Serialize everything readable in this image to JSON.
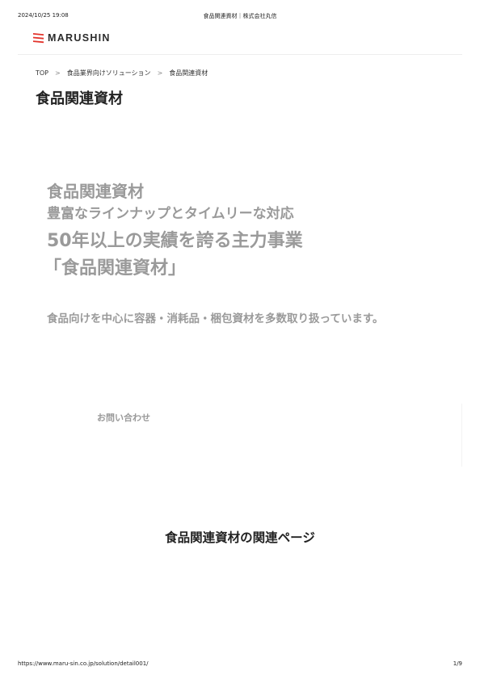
{
  "print_header": {
    "datetime": "2024/10/25 19:08",
    "doc_title": "食品関連資材｜株式会社丸信"
  },
  "site_header": {
    "logo_text": "MARUSHIN",
    "logo_icon": "marushin-logo-mark",
    "brand_color": "#e2322a"
  },
  "breadcrumb": {
    "items": [
      "TOP",
      "食品業界向けソリューション",
      "食品関連資材"
    ],
    "separator": ">"
  },
  "page_title": "食品関連資材",
  "hero": {
    "line1": "食品関連資材",
    "line2": "豊富なラインナップとタイムリーな対応",
    "line3": "50年以上の実績を誇る主力事業",
    "line4": "「食品関連資材」",
    "description": "食品向けを中心に容器・消耗品・梱包資材を多数取り扱っています。",
    "text_color": "#9a9a9a"
  },
  "contact": {
    "label": "お問い合わせ"
  },
  "related": {
    "title": "食品関連資材の関連ページ"
  },
  "print_footer": {
    "url": "https://www.maru-sin.co.jp/solution/detail001/",
    "page": "1/9"
  }
}
